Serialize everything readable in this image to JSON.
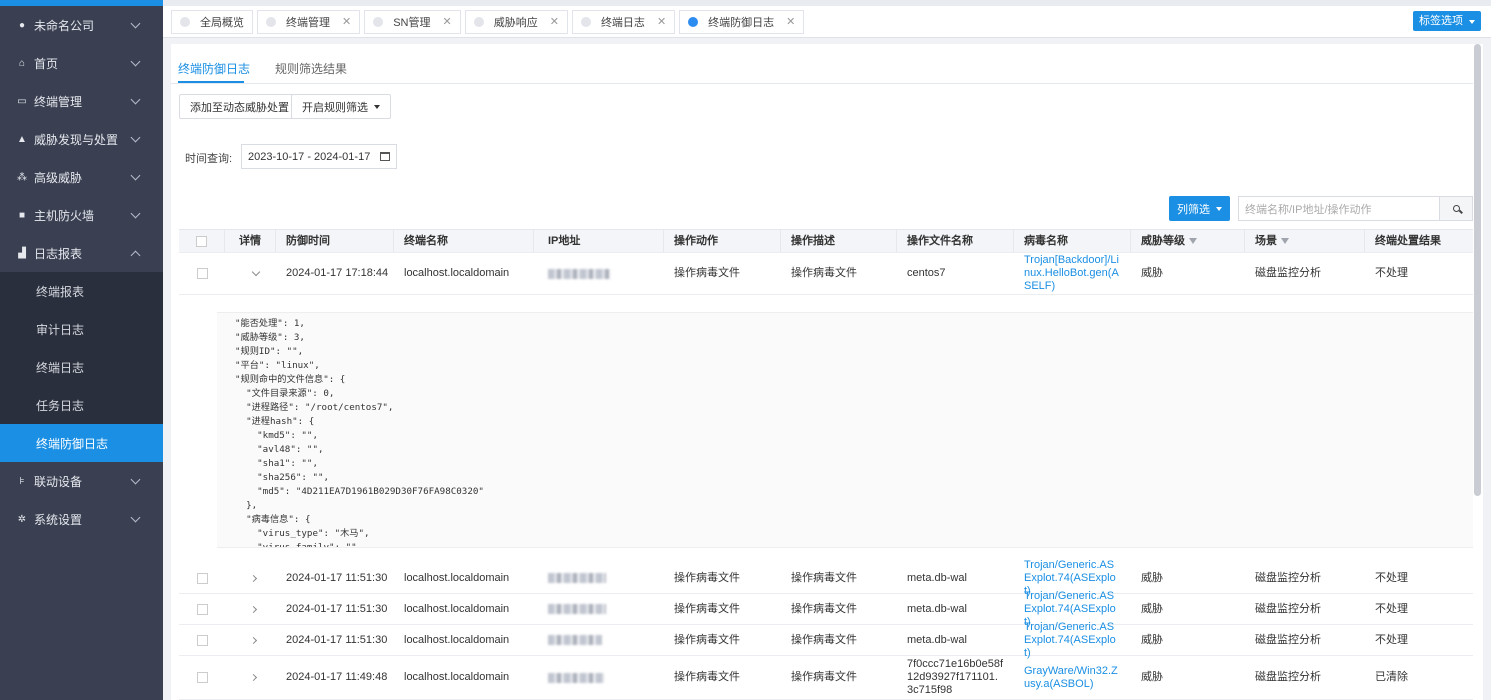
{
  "sidebar": {
    "items": [
      {
        "label": "未命名公司",
        "icon": "location-pin-icon"
      },
      {
        "label": "首页",
        "icon": "home-icon"
      },
      {
        "label": "终端管理",
        "icon": "monitor-icon"
      },
      {
        "label": "威胁发现与处置",
        "icon": "warning-icon"
      },
      {
        "label": "高级威胁",
        "icon": "nodes-icon"
      },
      {
        "label": "主机防火墙",
        "icon": "square-icon"
      },
      {
        "label": "日志报表",
        "icon": "bar-chart-icon"
      }
    ],
    "sub_items": [
      "终端报表",
      "审计日志",
      "终端日志",
      "任务日志",
      "终端防御日志"
    ],
    "bottom_items": [
      {
        "label": "联动设备",
        "icon": "link-device-icon"
      },
      {
        "label": "系统设置",
        "icon": "gear-icon"
      }
    ]
  },
  "tabs": [
    {
      "label": "全局概览"
    },
    {
      "label": "终端管理"
    },
    {
      "label": "SN管理"
    },
    {
      "label": "威胁响应"
    },
    {
      "label": "终端日志"
    },
    {
      "label": "终端防御日志"
    }
  ],
  "tab_options_label": "标签选项",
  "subtabs": [
    "终端防御日志",
    "规则筛选结果"
  ],
  "toolbar": {
    "add_label": "添加至动态威胁处置",
    "rule_filter_label": "开启规则筛选"
  },
  "time": {
    "label": "时间查询:",
    "value": "2023-10-17 - 2024-01-17"
  },
  "column_filter_label": "列筛选",
  "search_placeholder": "终端名称/IP地址/操作动作",
  "table": {
    "headers": [
      "详情",
      "防御时间",
      "终端名称",
      "IP地址",
      "操作动作",
      "操作描述",
      "操作文件名称",
      "病毒名称",
      "威胁等级",
      "场景",
      "终端处置结果"
    ],
    "rows": [
      {
        "time": "2024-01-17 17:18:44",
        "host": "localhost.localdomain",
        "action": "操作病毒文件",
        "desc": "操作病毒文件",
        "file": "centos7",
        "virus": "Trojan[Backdoor]/Linux.HelloBot.gen(ASELF)",
        "level": "威胁",
        "scene": "磁盘监控分析",
        "result": "不处理"
      },
      {
        "time": "2024-01-17 11:51:30",
        "host": "localhost.localdomain",
        "action": "操作病毒文件",
        "desc": "操作病毒文件",
        "file": "meta.db-wal",
        "virus": "Trojan/Generic.ASExplot.74(ASExplot)",
        "level": "威胁",
        "scene": "磁盘监控分析",
        "result": "不处理"
      },
      {
        "time": "2024-01-17 11:51:30",
        "host": "localhost.localdomain",
        "action": "操作病毒文件",
        "desc": "操作病毒文件",
        "file": "meta.db-wal",
        "virus": "Trojan/Generic.ASExplot.74(ASExplot)",
        "level": "威胁",
        "scene": "磁盘监控分析",
        "result": "不处理"
      },
      {
        "time": "2024-01-17 11:51:30",
        "host": "localhost.localdomain",
        "action": "操作病毒文件",
        "desc": "操作病毒文件",
        "file": "meta.db-wal",
        "virus": "Trojan/Generic.ASExplot.74(ASExplot)",
        "level": "威胁",
        "scene": "磁盘监控分析",
        "result": "不处理"
      },
      {
        "time": "2024-01-17 11:49:48",
        "host": "localhost.localdomain",
        "action": "操作病毒文件",
        "desc": "操作病毒文件",
        "file": "7f0ccc71e16b0e58f12d93927f171101.3c715f98",
        "virus": "GrayWare/Win32.Zusy.a(ASBOL)",
        "level": "威胁",
        "scene": "磁盘监控分析",
        "result": "已清除"
      }
    ],
    "detail_text": "\"能否处理\": 1,\n\"威胁等级\": 3,\n\"规则ID\": \"\",\n\"平台\": \"linux\",\n\"规则命中的文件信息\": {\n  \"文件目录来源\": 0,\n  \"进程路径\": \"/root/centos7\",\n  \"进程hash\": {\n    \"kmd5\": \"\",\n    \"avl48\": \"\",\n    \"sha1\": \"\",\n    \"sha256\": \"\",\n    \"md5\": \"4D211EA7D1961B029D30F76FA98C0320\"\n  },\n  \"病毒信息\": {\n    \"virus_type\": \"木马\",\n    \"virus_family\": \"\""
  },
  "colors": {
    "accent": "#1a8fe3",
    "sidebar": "#3a4052",
    "sidebar_sub": "#2a2f3d"
  }
}
